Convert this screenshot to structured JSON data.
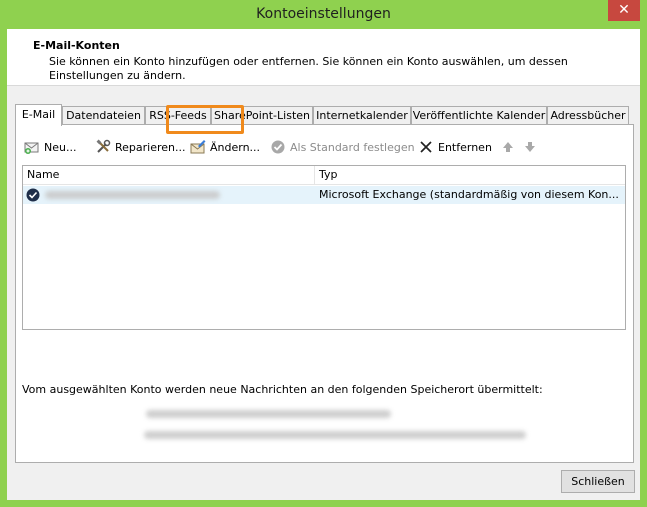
{
  "window": {
    "title": "Kontoeinstellungen",
    "close_glyph": "✕"
  },
  "header": {
    "title": "E-Mail-Konten",
    "description": "Sie können ein Konto hinzufügen oder entfernen. Sie können ein Konto auswählen, um dessen Einstellungen zu ändern."
  },
  "tabs": [
    {
      "label": "E-Mail"
    },
    {
      "label": "Datendateien"
    },
    {
      "label": "RSS-Feeds"
    },
    {
      "label": "SharePoint-Listen"
    },
    {
      "label": "Internetkalender"
    },
    {
      "label": "Veröffentlichte Kalender"
    },
    {
      "label": "Adressbücher"
    }
  ],
  "toolbar": {
    "new_label": "Neu...",
    "repair_label": "Reparieren...",
    "change_label": "Ändern...",
    "set_default_label": "Als Standard festlegen",
    "remove_label": "Entfernen"
  },
  "list": {
    "col_name": "Name",
    "col_type": "Typ",
    "rows": [
      {
        "type": "Microsoft Exchange (standardmäßig von diesem Kon..."
      }
    ]
  },
  "info_text": "Vom ausgewählten Konto werden neue Nachrichten an den folgenden Speicherort übermittelt:",
  "footer": {
    "close_label": "Schließen"
  },
  "colors": {
    "titlebar": "#8fd14f",
    "highlight": "#f08a1c",
    "close": "#c7483f"
  }
}
